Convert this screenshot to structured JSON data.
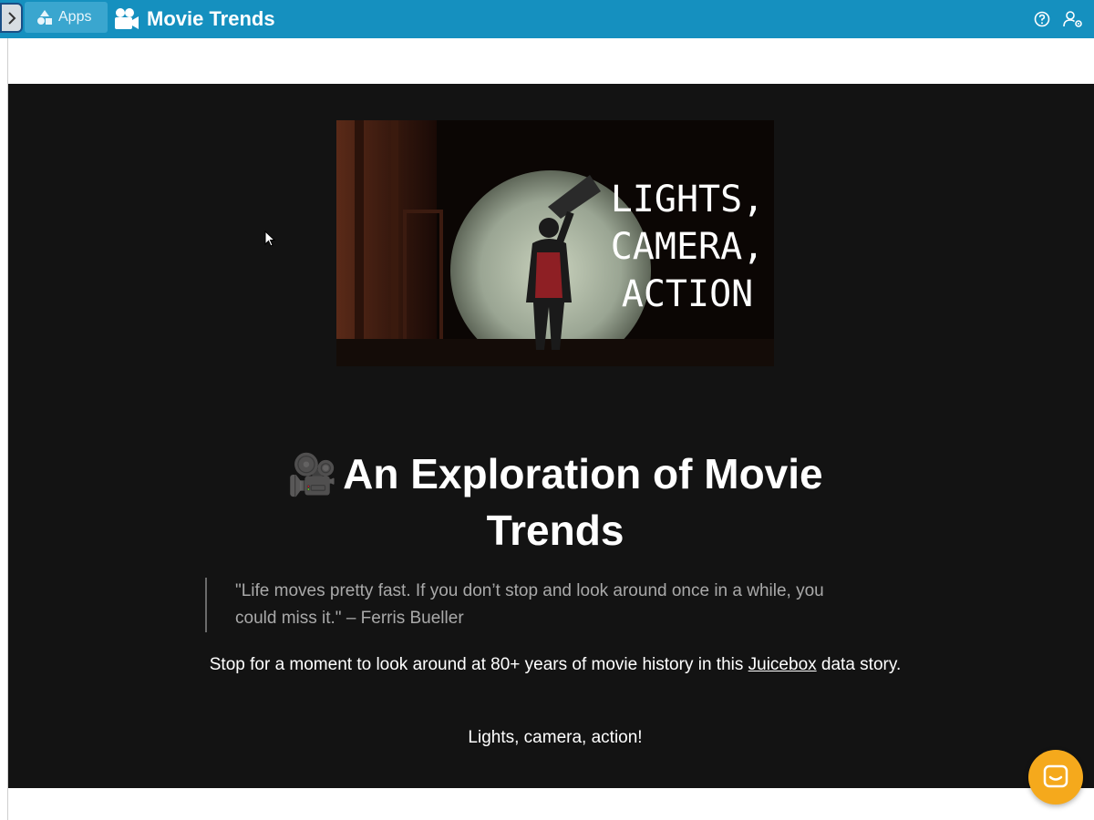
{
  "topbar": {
    "apps_label": "Apps",
    "app_title": "Movie Trends",
    "brand_color": "#1590bf",
    "icons": [
      "chevron-right-icon",
      "shapes-icon",
      "movie-camera-icon",
      "help-icon",
      "user-settings-icon"
    ]
  },
  "story": {
    "hero_image": {
      "caption_lines": [
        "LIGHTS,",
        "CAMERA,",
        "ACTION"
      ]
    },
    "heading_emoji": "🎥",
    "heading": "An Exploration of Movie Trends",
    "quote": "\"Life moves pretty fast. If you don’t stop and look around once in a while, you could miss it.\" – Ferris Bueller",
    "intro_before_link": "Stop for a moment to look around at 80+ years of movie history in this ",
    "intro_link": "Juicebox",
    "intro_after_link": " data story.",
    "tagline": "Lights, camera, action!",
    "background_color": "#131313"
  },
  "chat": {
    "icon": "chat-icon",
    "color": "#f5a91c"
  }
}
